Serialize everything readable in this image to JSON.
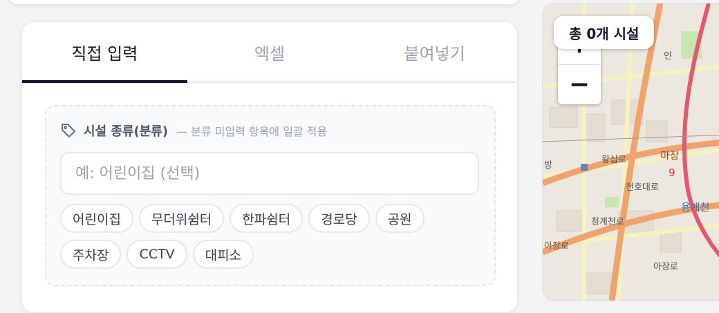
{
  "tabs": [
    {
      "label": "직접 입력",
      "active": true
    },
    {
      "label": "엑셀",
      "active": false
    },
    {
      "label": "붙여넣기",
      "active": false
    }
  ],
  "category": {
    "title": "시설 종류(분류)",
    "hint": "— 분류 미입력 항목에 일괄 적용",
    "input_placeholder": "예: 어린이집 (선택)",
    "input_value": "",
    "icon": "tag-icon",
    "chips": [
      "어린이집",
      "무더위쉼터",
      "한파쉼터",
      "경로당",
      "공원",
      "주차장",
      "CCTV",
      "대피소"
    ]
  },
  "map": {
    "count_badge": "총 0개 시설",
    "zoom_in_label": "+",
    "zoom_out_label": "−",
    "labels": [
      "왕십로",
      "천호대로",
      "청계천로",
      "아장로",
      "마장",
      "9",
      "용계천",
      "방",
      "아장로",
      "인"
    ]
  },
  "colors": {
    "accent": "#111827",
    "road_major": "#f0a46d",
    "road_minor": "#f7f3c1",
    "map_bg": "#ece8df",
    "park": "#c8e6b4",
    "metro": "#e5576a"
  }
}
